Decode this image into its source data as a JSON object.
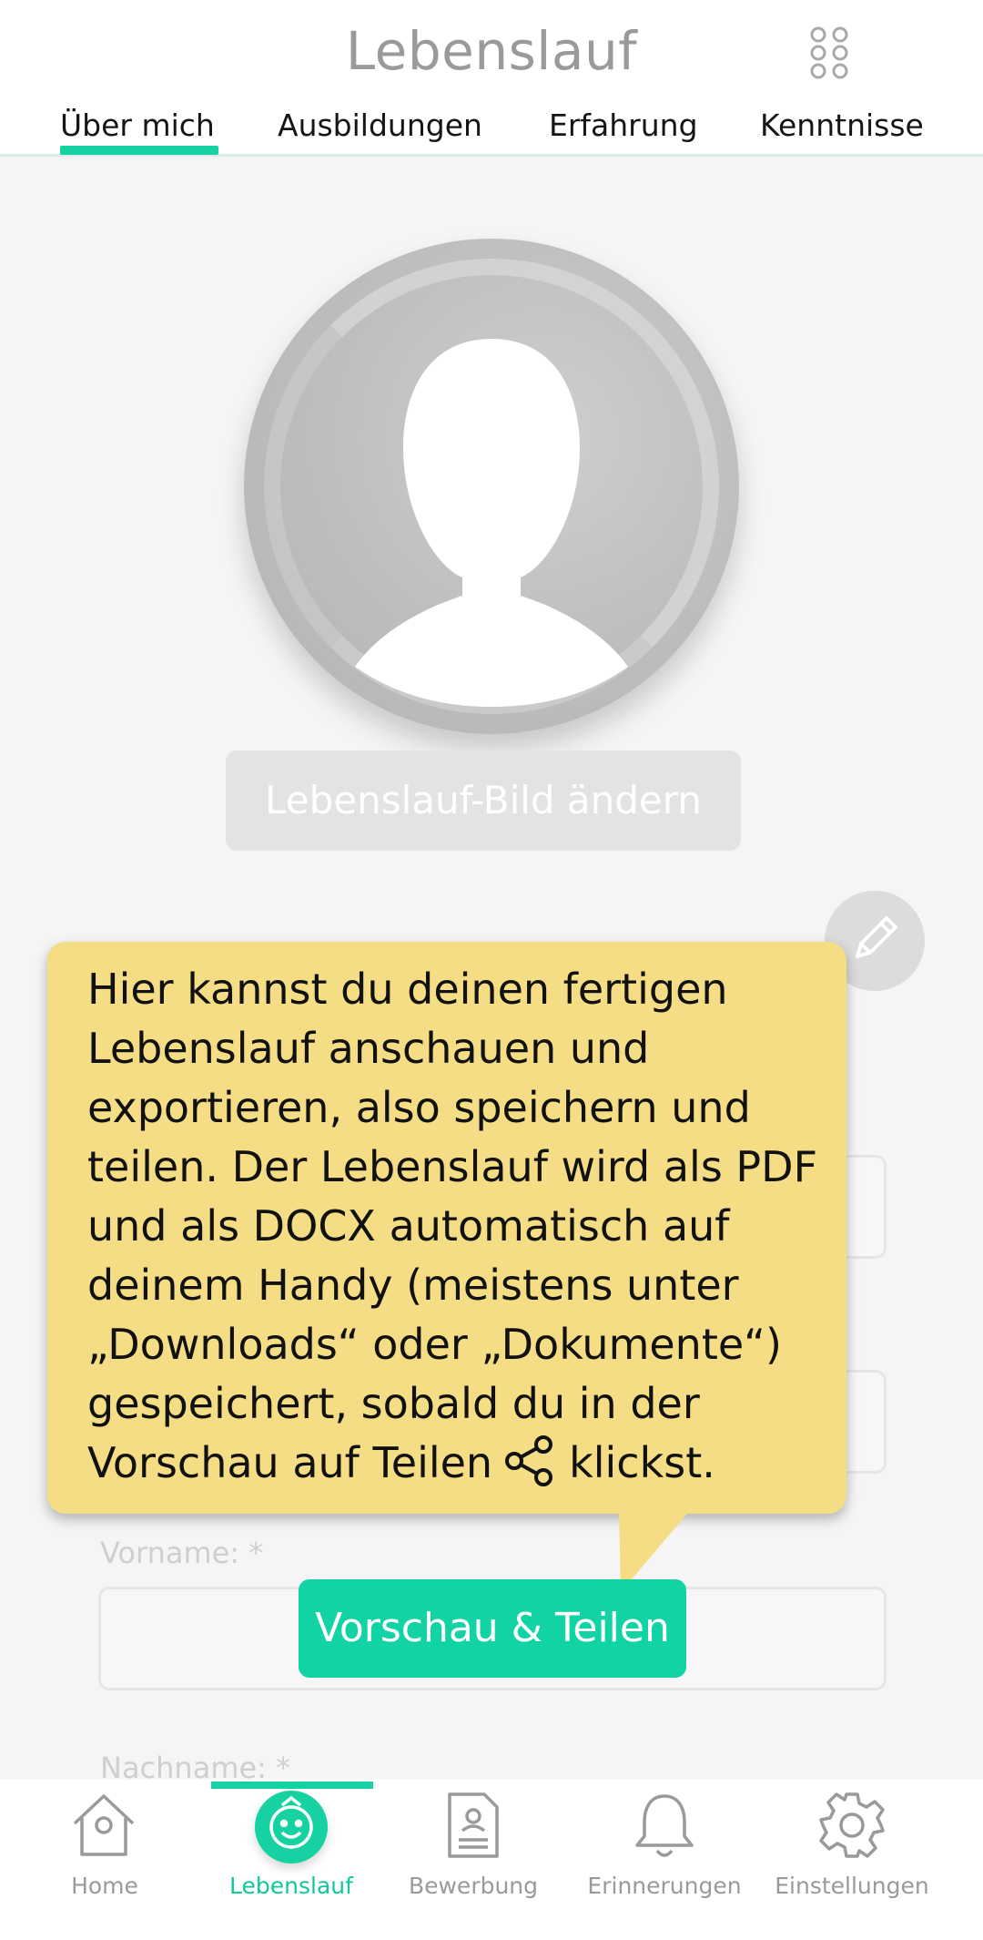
{
  "header": {
    "title": "Lebenslauf",
    "menu_icon": "grid-dots-icon",
    "tabs": [
      {
        "label": "Über mich",
        "active": true
      },
      {
        "label": "Ausbildungen",
        "active": false
      },
      {
        "label": "Erfahrung",
        "active": false
      },
      {
        "label": "Kenntnisse",
        "active": false
      }
    ]
  },
  "profile": {
    "avatar_icon": "user-silhouette-icon",
    "change_picture_label": "Lebenslauf-Bild ändern",
    "edit_icon": "pencil-icon"
  },
  "form": {
    "vorname_label": "Vorname: *",
    "nachname_label": "Nachname: *"
  },
  "tooltip": {
    "text_before": "Hier kannst du deinen fertigen Lebenslauf anschauen und exportieren, also speichern und teilen. Der Lebenslauf wird als PDF und als DOCX automatisch auf deinem Handy (meistens unter „Downloads“ oder „Dokumente“) gespeichert, sobald du in der Vorschau auf Teilen",
    "share_icon": "share-icon",
    "text_after": "klickst."
  },
  "preview_button": {
    "label": "Vorschau & Teilen"
  },
  "bottom_nav": {
    "items": [
      {
        "label": "Home",
        "icon": "home-icon",
        "active": false
      },
      {
        "label": "Lebenslauf",
        "icon": "smiley-icon",
        "active": true
      },
      {
        "label": "Bewerbung",
        "icon": "document-icon",
        "active": false
      },
      {
        "label": "Erinnerungen",
        "icon": "bell-icon",
        "active": false
      },
      {
        "label": "Einstellungen",
        "icon": "gear-icon",
        "active": false
      }
    ]
  },
  "colors": {
    "accent": "#16d1a2",
    "tooltip_bg": "#f4dd84",
    "inactive_text": "#9a9a9a"
  }
}
